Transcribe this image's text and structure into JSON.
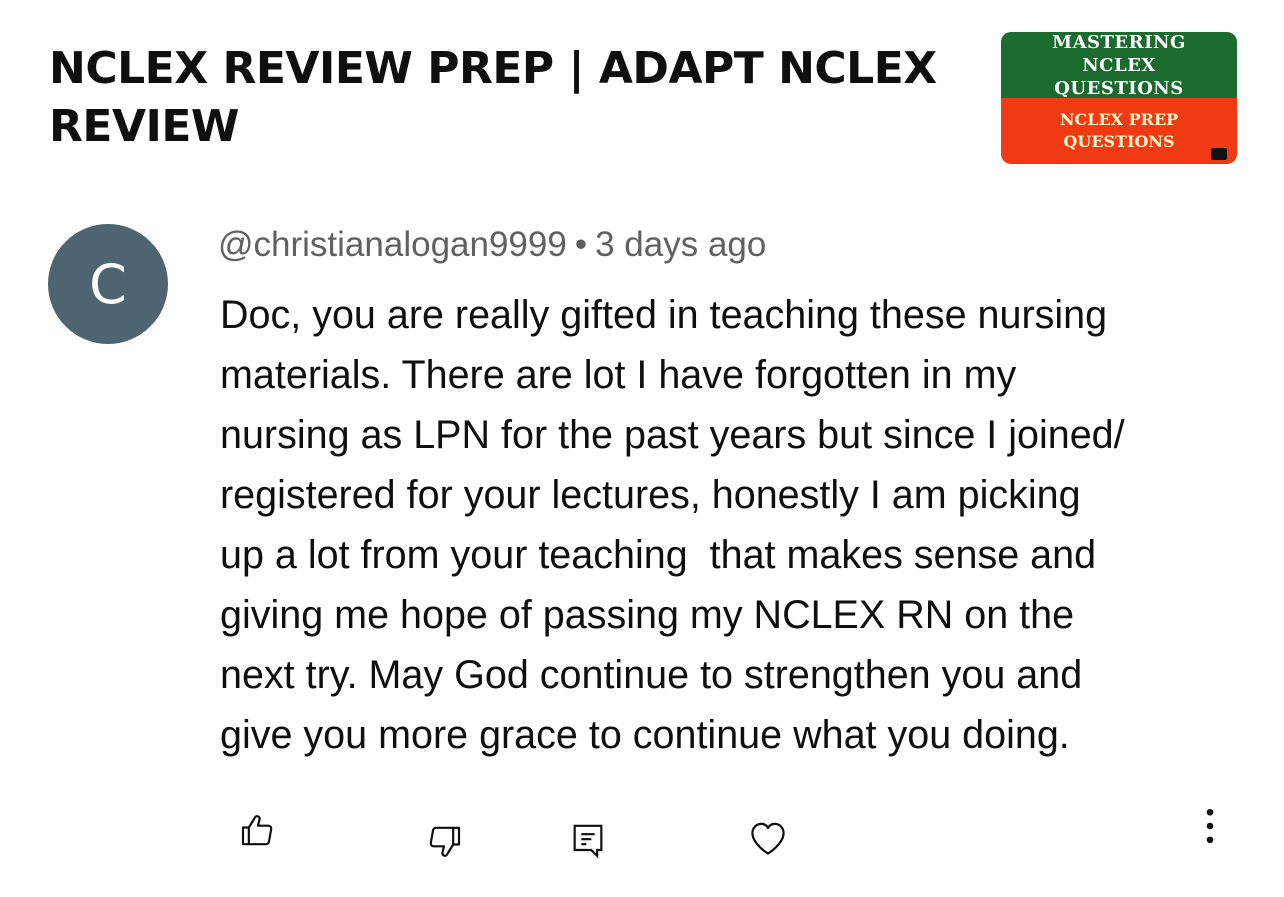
{
  "video": {
    "title": "NCLEX REVIEW PREP | ADAPT NCLEX REVIEW",
    "thumbnail": {
      "top_line1": "MASTERING",
      "top_line2": "NCLEX",
      "top_line3": "QUESTIONS",
      "bottom_line1": "NCLEX PREP",
      "bottom_line2": "QUESTIONS",
      "top_color": "#1b6b2f",
      "bottom_color": "#f03a14"
    }
  },
  "comment": {
    "avatar_letter": "C",
    "avatar_color": "#4f6471",
    "author": "@christianalogan9999",
    "separator": "•",
    "timestamp": "3 days ago",
    "lines": [
      "Doc, you are really gifted in teaching these nursing",
      "materials. There are lot I have forgotten in my",
      "nursing as LPN for the past years but since I joined/",
      "registered for your lectures, honestly I am picking",
      "up a lot from your teaching  that makes sense and",
      "giving me hope of passing my NCLEX RN on the",
      "next try. May God continue to strengthen you and",
      "give you more grace to continue what you doing."
    ]
  },
  "actions": {
    "like_icon": "thumbs-up-icon",
    "dislike_icon": "thumbs-down-icon",
    "reply_icon": "reply-comment-icon",
    "heart_icon": "heart-icon",
    "more_icon": "more-vertical-icon"
  }
}
